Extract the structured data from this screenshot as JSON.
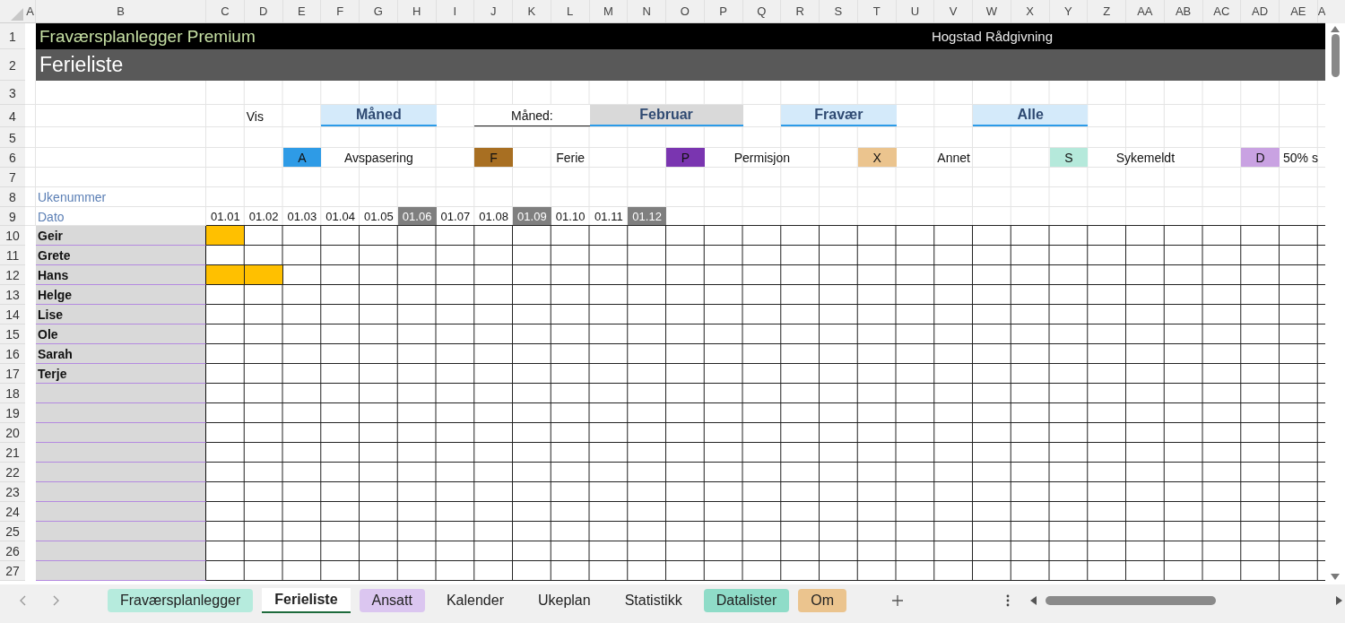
{
  "column_headers": [
    "A",
    "B",
    "C",
    "D",
    "E",
    "F",
    "G",
    "H",
    "I",
    "J",
    "K",
    "L",
    "M",
    "N",
    "O",
    "P",
    "Q",
    "R",
    "S",
    "T",
    "U",
    "V",
    "W",
    "X",
    "Y",
    "Z",
    "AA",
    "AB",
    "AC",
    "AD",
    "AE",
    "A"
  ],
  "row_numbers": [
    "1",
    "2",
    "3",
    "4",
    "5",
    "6",
    "7",
    "8",
    "9",
    "10",
    "11",
    "12",
    "13",
    "14",
    "15",
    "16",
    "17",
    "18",
    "19",
    "20",
    "21",
    "22",
    "23",
    "24",
    "25",
    "26",
    "27"
  ],
  "title_bar": {
    "title": "Fraværsplanlegger Premium",
    "company": "Hogstad Rådgivning"
  },
  "sheet_title": "Ferieliste",
  "controls": {
    "view_label": "Vis",
    "view_button": "Måned",
    "month_label": "Måned:",
    "month_value": "Februar",
    "type_button": "Fravær",
    "filter_button": "Alle"
  },
  "legend": [
    {
      "code": "A",
      "label": "Avspasering",
      "color": "#2e9be6"
    },
    {
      "code": "F",
      "label": "Ferie",
      "color": "#a86f22"
    },
    {
      "code": "P",
      "label": "Permisjon",
      "color": "#7a35b0"
    },
    {
      "code": "X",
      "label": "Annet",
      "color": "#ebc48e"
    },
    {
      "code": "S",
      "label": "Sykemeldt",
      "color": "#b5e9db"
    },
    {
      "code": "D",
      "label": "50% s",
      "color": "#c9a2e2"
    }
  ],
  "week_label": "Ukenummer",
  "date_label": "Dato",
  "dates": [
    {
      "text": "01.01",
      "weekend": false
    },
    {
      "text": "01.02",
      "weekend": false
    },
    {
      "text": "01.03",
      "weekend": false
    },
    {
      "text": "01.04",
      "weekend": false
    },
    {
      "text": "01.05",
      "weekend": false
    },
    {
      "text": "01.06",
      "weekend": true
    },
    {
      "text": "01.07",
      "weekend": false
    },
    {
      "text": "01.08",
      "weekend": false
    },
    {
      "text": "01.09",
      "weekend": true
    },
    {
      "text": "01.10",
      "weekend": false
    },
    {
      "text": "01.11",
      "weekend": false
    },
    {
      "text": "01.12",
      "weekend": true
    }
  ],
  "employees": [
    {
      "name": "Geir",
      "marked_days": [
        true
      ]
    },
    {
      "name": "Grete"
    },
    {
      "name": "Hans",
      "marked_days": [
        true,
        true
      ]
    },
    {
      "name": "Helge"
    },
    {
      "name": "Lise"
    },
    {
      "name": "Ole"
    },
    {
      "name": "Sarah"
    },
    {
      "name": "Terje"
    }
  ],
  "tabs": [
    {
      "label": "Fraværsplanlegger",
      "selected": false,
      "color": "#b6ebdd"
    },
    {
      "label": "Ferieliste",
      "selected": true
    },
    {
      "label": "Ansatt",
      "selected": false,
      "color": "#dbc6f0"
    },
    {
      "label": "Kalender",
      "selected": false
    },
    {
      "label": "Ukeplan",
      "selected": false
    },
    {
      "label": "Statistikk",
      "selected": false
    },
    {
      "label": "Datalister",
      "selected": false,
      "color": "#8fdcc8"
    },
    {
      "label": "Om",
      "selected": false,
      "color": "#ebc48e"
    }
  ]
}
